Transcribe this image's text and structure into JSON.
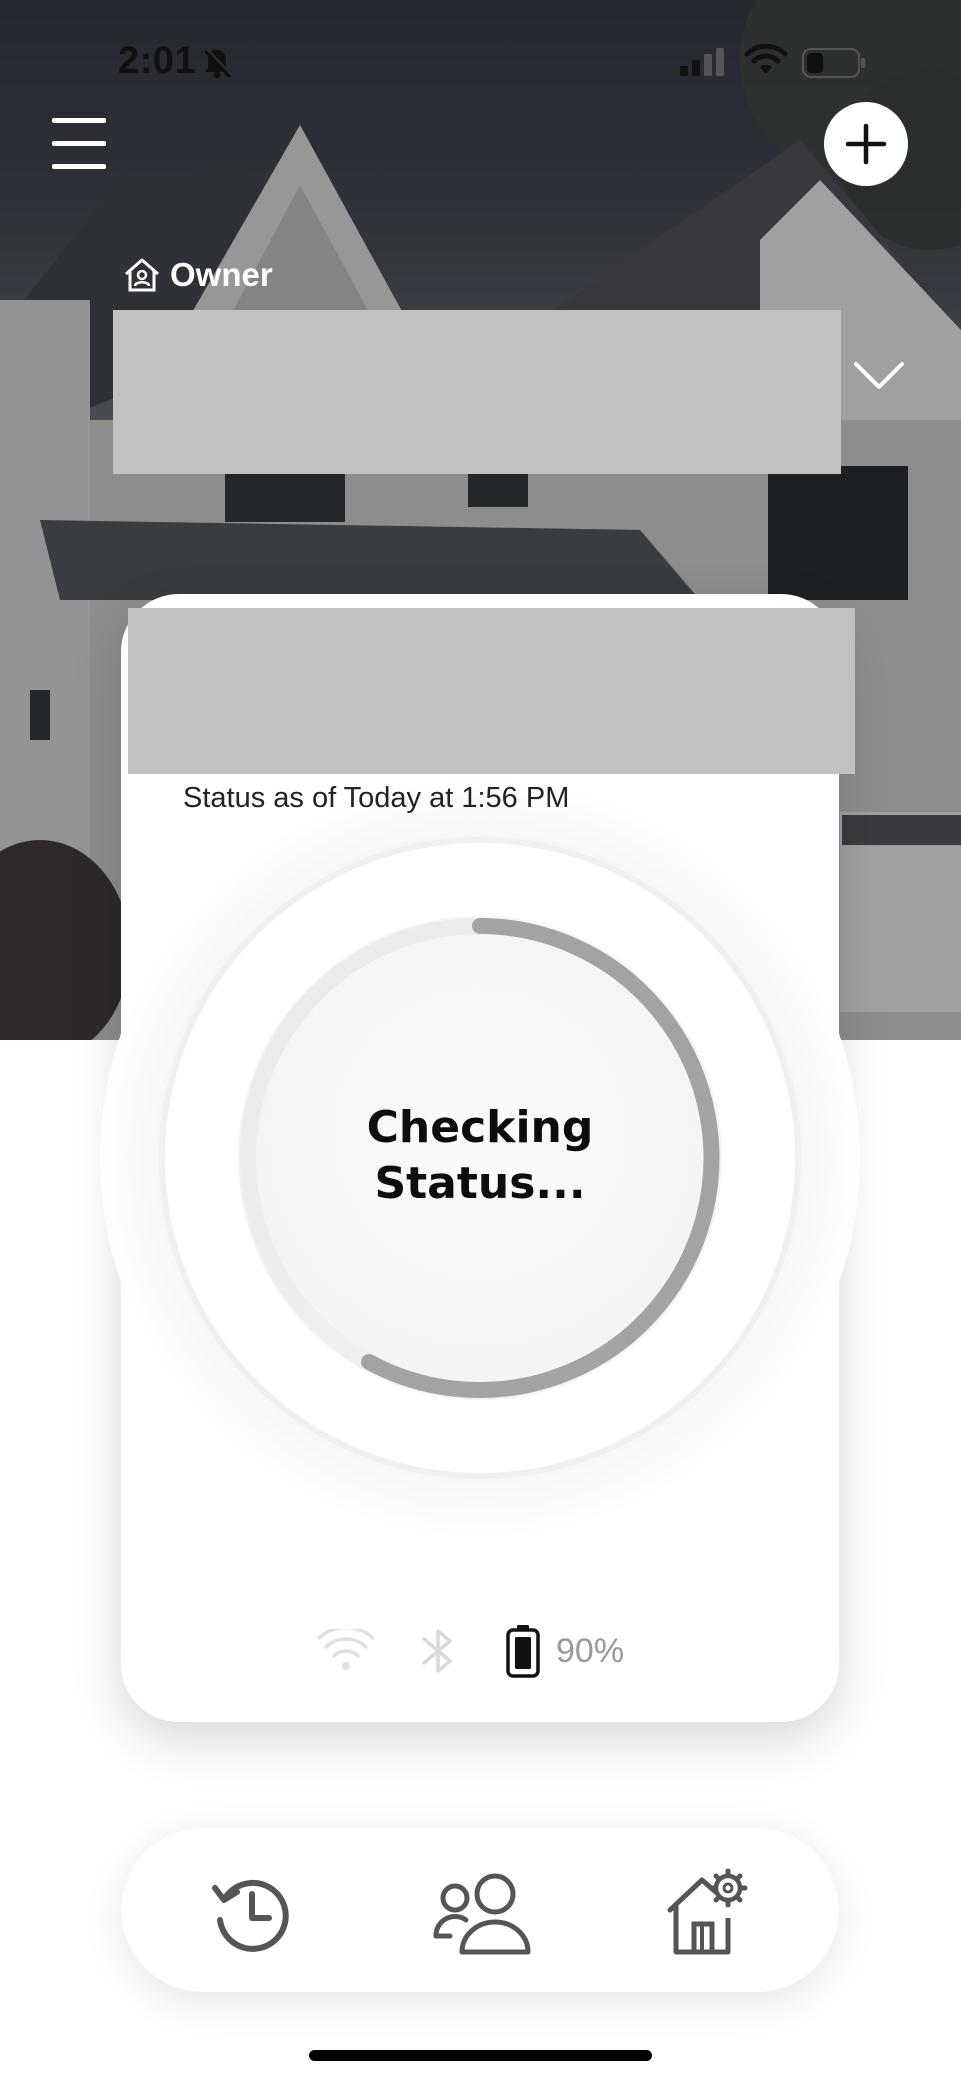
{
  "status_bar": {
    "time": "2:01",
    "icons": [
      "bell-slash-icon",
      "cellular-signal-icon",
      "wifi-icon",
      "battery-icon"
    ]
  },
  "header": {
    "menu_icon": "hamburger-menu-icon",
    "add_icon": "plus-icon",
    "owner_icon": "home-user-icon",
    "owner_label": "Owner",
    "home_selector_icon": "chevron-down-icon"
  },
  "lock_card": {
    "status_text": "Status as of Today at 1:56 PM",
    "checking_line1": "Checking",
    "checking_line2": "Status...",
    "battery_percent": "90%",
    "icons": [
      "wifi-icon",
      "bluetooth-icon",
      "battery-icon"
    ]
  },
  "bottom_nav": {
    "items": [
      {
        "icon": "history-icon"
      },
      {
        "icon": "users-icon"
      },
      {
        "icon": "home-settings-icon"
      }
    ]
  },
  "colors": {
    "card_bg": "#ffffff",
    "redacted": "#c1c1c1",
    "ring": "#a3a3a3",
    "text_dark": "#0d0d0d"
  }
}
